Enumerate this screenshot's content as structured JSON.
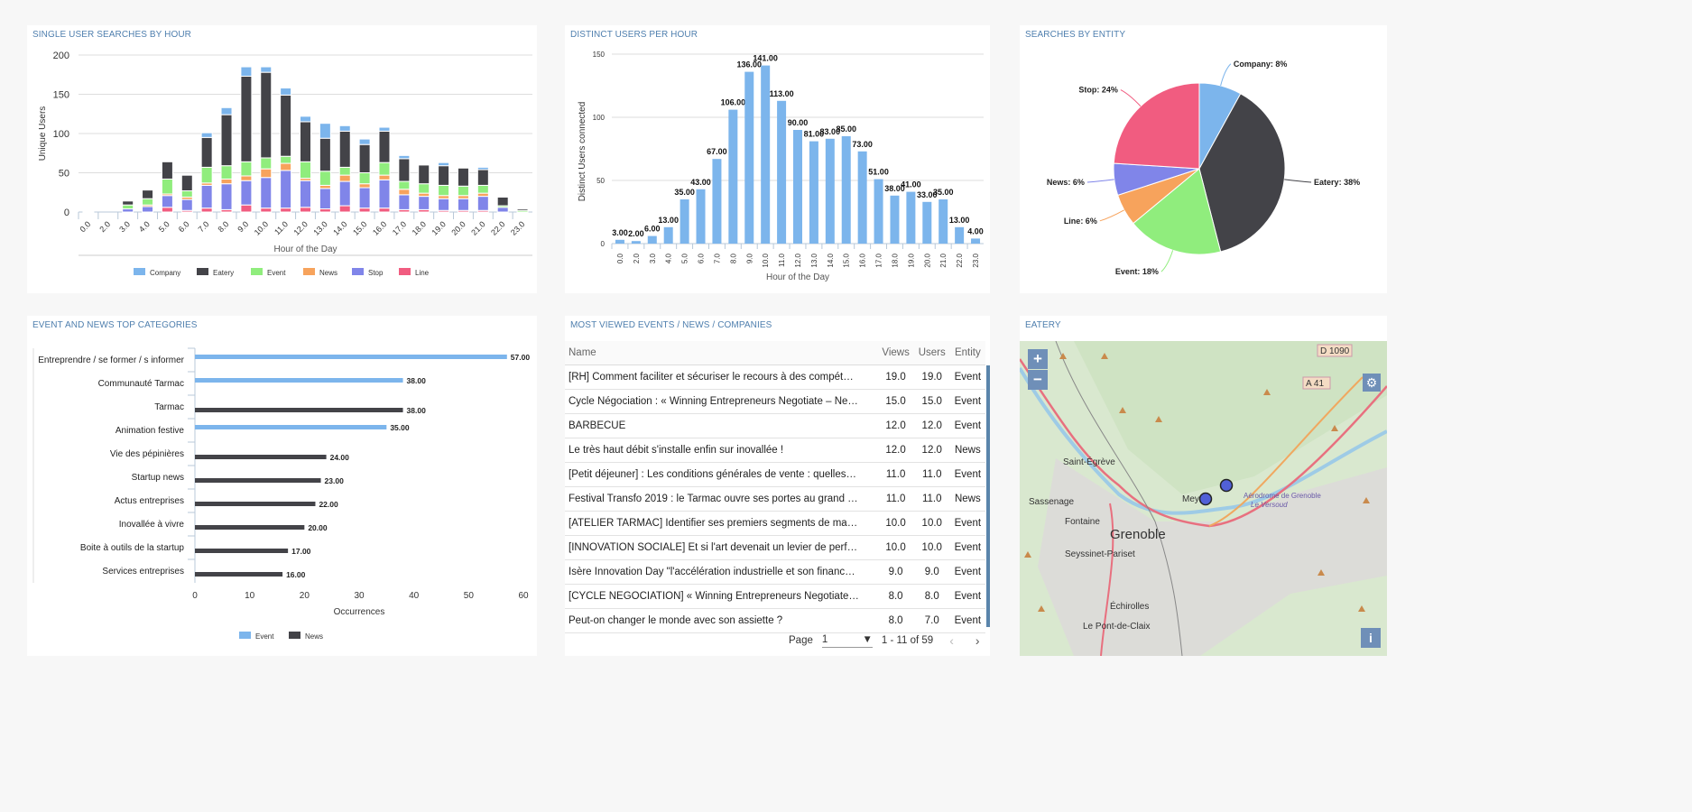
{
  "colors": {
    "company": "#7cb5ec",
    "eatery": "#434348",
    "event": "#90ed7d",
    "news": "#f7a35c",
    "stop": "#8085e9",
    "line": "#f15c80",
    "title": "#4f7fae"
  },
  "panels": {
    "single_user": "SINGLE USER SEARCHES BY HOUR",
    "distinct": "DISTINCT USERS PER HOUR",
    "entity": "SEARCHES BY ENTITY",
    "categories": "EVENT AND NEWS TOP CATEGORIES",
    "most_viewed": "MOST VIEWED EVENTS / NEWS / COMPANIES",
    "eatery": "EATERY"
  },
  "chart_data": [
    {
      "type": "bar",
      "stacked": true,
      "title": "SINGLE USER SEARCHES BY HOUR",
      "xlabel": "Hour of the Day",
      "ylabel": "Unique Users",
      "ylim": [
        0,
        200
      ],
      "yticks": [
        0,
        50,
        100,
        150,
        200
      ],
      "grid": true,
      "legend": "bottom",
      "categories": [
        "0.0",
        "2.0",
        "3.0",
        "4.0",
        "5.0",
        "6.0",
        "7.0",
        "8.0",
        "9.0",
        "10.0",
        "11.0",
        "12.0",
        "13.0",
        "14.0",
        "15.0",
        "16.0",
        "17.0",
        "18.0",
        "19.0",
        "20.0",
        "21.0",
        "22.0",
        "23.0"
      ],
      "series": [
        {
          "name": "Line",
          "color": "#f15c80",
          "values": [
            0,
            0,
            0,
            0,
            6,
            2,
            5,
            3,
            9,
            5,
            5,
            6,
            4,
            8,
            5,
            5,
            3,
            3,
            2,
            2,
            2,
            0,
            0
          ]
        },
        {
          "name": "Stop",
          "color": "#8085e9",
          "values": [
            0,
            0,
            4,
            7,
            15,
            14,
            29,
            33,
            31,
            39,
            48,
            34,
            26,
            31,
            26,
            36,
            19,
            17,
            15,
            15,
            18,
            6,
            0
          ]
        },
        {
          "name": "News",
          "color": "#f7a35c",
          "values": [
            0,
            0,
            0,
            2,
            2,
            3,
            3,
            6,
            6,
            11,
            9,
            3,
            4,
            8,
            5,
            6,
            7,
            4,
            4,
            4,
            4,
            0,
            0
          ]
        },
        {
          "name": "Event",
          "color": "#90ed7d",
          "values": [
            0,
            0,
            5,
            8,
            19,
            8,
            20,
            17,
            18,
            14,
            9,
            21,
            18,
            10,
            14,
            16,
            10,
            12,
            13,
            12,
            10,
            2,
            2
          ]
        },
        {
          "name": "Eatery",
          "color": "#434348",
          "values": [
            0,
            0,
            5,
            11,
            22,
            20,
            38,
            65,
            109,
            109,
            78,
            51,
            42,
            46,
            36,
            40,
            29,
            24,
            25,
            23,
            20,
            11,
            2
          ]
        },
        {
          "name": "Company",
          "color": "#7cb5ec",
          "values": [
            1,
            0,
            0,
            0,
            0,
            1,
            6,
            9,
            12,
            7,
            9,
            7,
            19,
            7,
            7,
            5,
            4,
            1,
            4,
            0,
            3,
            0,
            0
          ]
        }
      ],
      "legend_order": [
        "Company",
        "Eatery",
        "Event",
        "News",
        "Stop",
        "Line"
      ]
    },
    {
      "type": "bar",
      "title": "DISTINCT USERS PER HOUR",
      "xlabel": "Hour of the Day",
      "ylabel": "Distinct Users connected",
      "ylim": [
        0,
        150
      ],
      "yticks": [
        0,
        50,
        100,
        150
      ],
      "grid": true,
      "categories": [
        "0.0",
        "2.0",
        "3.0",
        "4.0",
        "5.0",
        "6.0",
        "7.0",
        "8.0",
        "9.0",
        "10.0",
        "11.0",
        "12.0",
        "13.0",
        "14.0",
        "15.0",
        "16.0",
        "17.0",
        "18.0",
        "19.0",
        "20.0",
        "21.0",
        "22.0",
        "23.0"
      ],
      "values": [
        3,
        2,
        6,
        13,
        35,
        43,
        67,
        106,
        136,
        141,
        113,
        90,
        81,
        83,
        85,
        73,
        51,
        38,
        41,
        33,
        35,
        13,
        4
      ],
      "labels": [
        "3.00",
        "2.00",
        "6.00",
        "13.00",
        "35.00",
        "43.00",
        "67.00",
        "106.00",
        "136.00",
        "141.00",
        "113.00",
        "90.00",
        "81.00",
        "83.00",
        "85.00",
        "73.00",
        "51.00",
        "38.00",
        "41.00",
        "33.00",
        "35.00",
        "13.00",
        "4.00"
      ],
      "color": "#7cb5ec"
    },
    {
      "type": "pie",
      "title": "SEARCHES BY ENTITY",
      "slices": [
        {
          "name": "Company",
          "value": 8,
          "label": "Company: 8%",
          "color": "#7cb5ec"
        },
        {
          "name": "Eatery",
          "value": 38,
          "label": "Eatery: 38%",
          "color": "#434348"
        },
        {
          "name": "Event",
          "value": 18,
          "label": "Event: 18%",
          "color": "#90ed7d"
        },
        {
          "name": "Line",
          "value": 6,
          "label": "Line: 6%",
          "color": "#f7a35c"
        },
        {
          "name": "News",
          "value": 6,
          "label": "News: 6%",
          "color": "#8085e9"
        },
        {
          "name": "Stop",
          "value": 24,
          "label": "Stop: 24%",
          "color": "#f15c80"
        }
      ]
    },
    {
      "type": "bar",
      "orientation": "horizontal",
      "title": "EVENT AND NEWS TOP CATEGORIES",
      "xlabel": "Occurrences",
      "xlim": [
        0,
        60
      ],
      "xticks": [
        0,
        10,
        20,
        30,
        40,
        50,
        60
      ],
      "legend": "bottom",
      "categories": [
        "Entreprendre / se former / s informer",
        "Communauté Tarmac",
        "Tarmac",
        "Animation festive",
        "Vie des pépinières",
        "Startup news",
        "Actus entreprises",
        "Inovallée à vivre",
        "Boite à outils de la startup",
        "Services entreprises"
      ],
      "series": [
        {
          "name": "Event",
          "color": "#7cb5ec",
          "values": [
            57,
            38,
            null,
            35,
            null,
            null,
            null,
            null,
            null,
            null
          ]
        },
        {
          "name": "News",
          "color": "#434348",
          "values": [
            null,
            null,
            38,
            null,
            24,
            23,
            22,
            20,
            17,
            16
          ]
        }
      ],
      "labels": [
        "57.00",
        "38.00",
        "38.00",
        "35.00",
        "24.00",
        "23.00",
        "22.00",
        "20.00",
        "17.00",
        "16.00"
      ]
    }
  ],
  "table": {
    "headers": [
      "Name",
      "Views",
      "Users",
      "Entity"
    ],
    "rows": [
      [
        "[RH] Comment faciliter et sécuriser le recours à des compétences...",
        "19.0",
        "19.0",
        "Event"
      ],
      [
        "Cycle Négociation : « Winning Entrepreneurs Negotiate – Negotiat...",
        "15.0",
        "15.0",
        "Event"
      ],
      [
        "BARBECUE",
        "12.0",
        "12.0",
        "Event"
      ],
      [
        "Le très haut débit s'installe enfin sur inovallée !",
        "12.0",
        "12.0",
        "News"
      ],
      [
        "[Petit déjeuner] : Les conditions générales de vente : quelles bonn...",
        "11.0",
        "11.0",
        "Event"
      ],
      [
        "Festival Transfo 2019 : le Tarmac ouvre ses portes au grand publi...",
        "11.0",
        "11.0",
        "News"
      ],
      [
        "[ATELIER TARMAC] Identifier ses premiers segments de marché a...",
        "10.0",
        "10.0",
        "Event"
      ],
      [
        "[INNOVATION SOCIALE] Et si l'art devenait un levier de performan...",
        "10.0",
        "10.0",
        "Event"
      ],
      [
        "Isère Innovation Day \"l'accélération industrielle et son financement\"",
        "9.0",
        "9.0",
        "Event"
      ],
      [
        "[CYCLE NEGOCIATION] « Winning Entrepreneurs Negotiate – Neg...",
        "8.0",
        "8.0",
        "Event"
      ],
      [
        "Peut-on changer le monde avec son assiette ?",
        "8.0",
        "7.0",
        "Event"
      ]
    ],
    "pagination": {
      "page_label": "Page",
      "page": "1",
      "range": "1 - 11 of 59",
      "prev": "‹",
      "next": "›"
    }
  },
  "map": {
    "zoom_in": "+",
    "zoom_out": "−",
    "settings_icon": "gear-icon",
    "info": "i",
    "labels": [
      "D 1090",
      "A 41",
      "Saint-Égrève",
      "Sassenage",
      "Fontaine",
      "Grenoble",
      "Seyssinet-Pariset",
      "Échirolles",
      "Le Pont-de-Claix",
      "Mey",
      "Aérodrome de Grenoble",
      "Le Versoud"
    ],
    "markers": 2
  }
}
